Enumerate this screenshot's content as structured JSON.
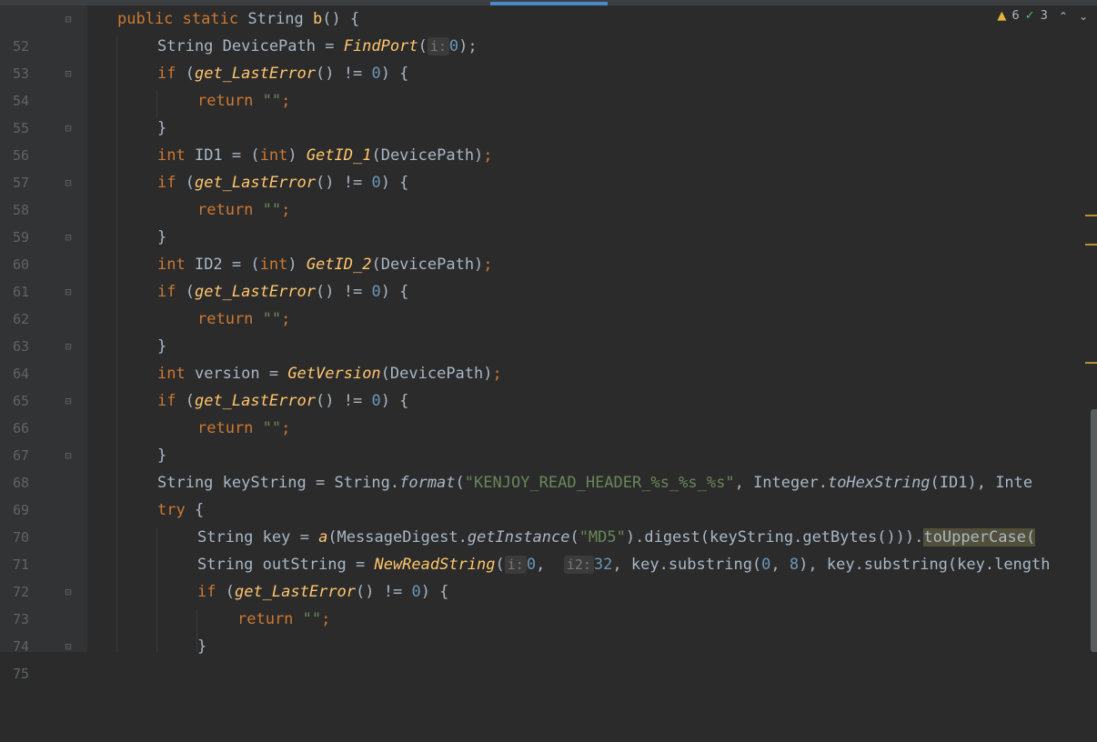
{
  "editor": {
    "inspections": {
      "warnings": "6",
      "weak_warnings": "3"
    },
    "lines": [
      {
        "n": "52"
      },
      {
        "n": "53"
      },
      {
        "n": "54"
      },
      {
        "n": "55"
      },
      {
        "n": "56"
      },
      {
        "n": "57"
      },
      {
        "n": "58"
      },
      {
        "n": "59"
      },
      {
        "n": "60"
      },
      {
        "n": "61"
      },
      {
        "n": "62"
      },
      {
        "n": "63"
      },
      {
        "n": "64"
      },
      {
        "n": "65"
      },
      {
        "n": "66"
      },
      {
        "n": "67"
      },
      {
        "n": "68"
      },
      {
        "n": "69"
      },
      {
        "n": "70"
      },
      {
        "n": "71"
      },
      {
        "n": "72"
      },
      {
        "n": "73"
      },
      {
        "n": "74"
      },
      {
        "n": "75"
      }
    ],
    "tok": {
      "public": "public",
      "static": "static",
      "String": "String",
      "b": "b",
      "sig_rest": "() {",
      "string_devpath": "String DevicePath = ",
      "FindPort": "FindPort",
      "paren_open": "(",
      "hint_i": "i:",
      "zero": "0",
      "close_semi": ");",
      "if": "if",
      "paren_sp": " (",
      "getLastError": "get_LastError",
      "ne_cond": "() != ",
      "close_brace": ") {",
      "return": "return",
      "empty_str": "\"\"",
      "semi": ";",
      "rbrace": "}",
      "int": "int",
      "id1_eq": " ID1 = (",
      "int_cast": "int",
      ") ": ") ",
      "GetID_1": "GetID_1",
      "devpath_arg": "(DevicePath)",
      "id2_eq": " ID2 = (",
      "GetID_2": "GetID_2",
      "version_eq": " version = ",
      "GetVersion": "GetVersion",
      "keystring_decl": "String keyString = String.",
      "format": "format",
      "fmt_str": "\"KENJOY_READ_HEADER_%s_%s_%s\"",
      "comma_integer": ", Integer.",
      "toHexString": "toHexString",
      "id1_rest": "(ID1), Inte",
      "try": "try",
      "space_brace": " {",
      "key_decl": "String key = ",
      "a": "a",
      "md_pre": "(MessageDigest.",
      "getInstance": "getInstance",
      "md5_str": "\"MD5\"",
      "digest_rest": ").digest(keyString.getBytes())).",
      "toUpperCase": "toUpperCase(",
      "out_decl": "String outString = ",
      "NewReadString": "NewReadString",
      "hint_i2": "i2:",
      "thirtytwo": "32",
      "substr_a": ", key.substring(",
      "comma_sp": ", ",
      "eight": "8",
      "substr_b": "), key.substring(key.length",
      "paren_space": "(",
      "semicolon": ";"
    }
  }
}
